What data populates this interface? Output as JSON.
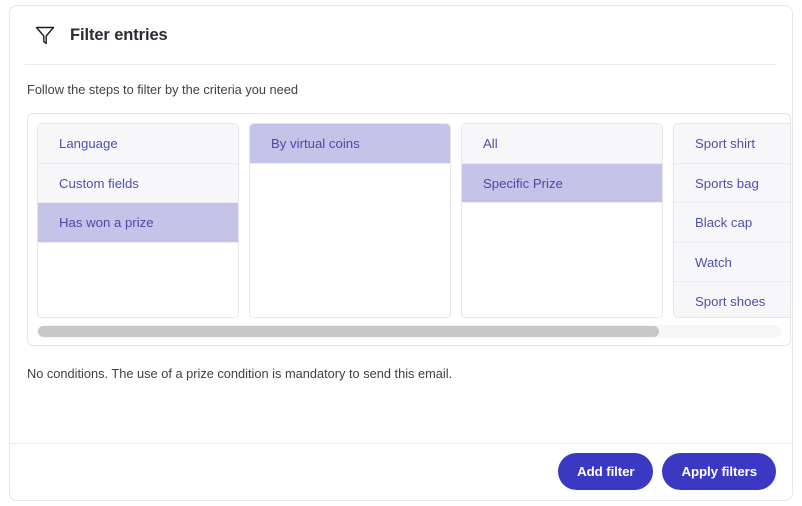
{
  "header": {
    "icon": "funnel-icon",
    "title": "Filter entries"
  },
  "subtitle": "Follow the steps to filter by the criteria you need",
  "filter_columns": [
    {
      "name": "criteria-column",
      "options": [
        {
          "label": "Language",
          "selected": false
        },
        {
          "label": "Custom fields",
          "selected": false
        },
        {
          "label": "Has won a prize",
          "selected": true
        }
      ]
    },
    {
      "name": "prize-type-column",
      "options": [
        {
          "label": "By virtual coins",
          "selected": true
        }
      ]
    },
    {
      "name": "prize-scope-column",
      "options": [
        {
          "label": "All",
          "selected": false
        },
        {
          "label": "Specific Prize",
          "selected": true
        }
      ]
    },
    {
      "name": "prize-list-column",
      "options": [
        {
          "label": "Sport shirt",
          "selected": false
        },
        {
          "label": "Sports bag",
          "selected": false
        },
        {
          "label": "Black cap",
          "selected": false
        },
        {
          "label": "Watch",
          "selected": false
        },
        {
          "label": "Sport shoes",
          "selected": false
        }
      ]
    }
  ],
  "scrollbar": {
    "orientation": "horizontal",
    "thumb_width_percent": 83.5
  },
  "conditions_note": "No conditions. The use of a prize condition is mandatory to send this email.",
  "footer": {
    "add_filter_label": "Add filter",
    "apply_filters_label": "Apply filters"
  },
  "colors": {
    "accent": "#3b39c4",
    "selected_bg": "#c4c4e8",
    "option_text": "#4f4fad",
    "option_bg": "#f7f7f9"
  }
}
